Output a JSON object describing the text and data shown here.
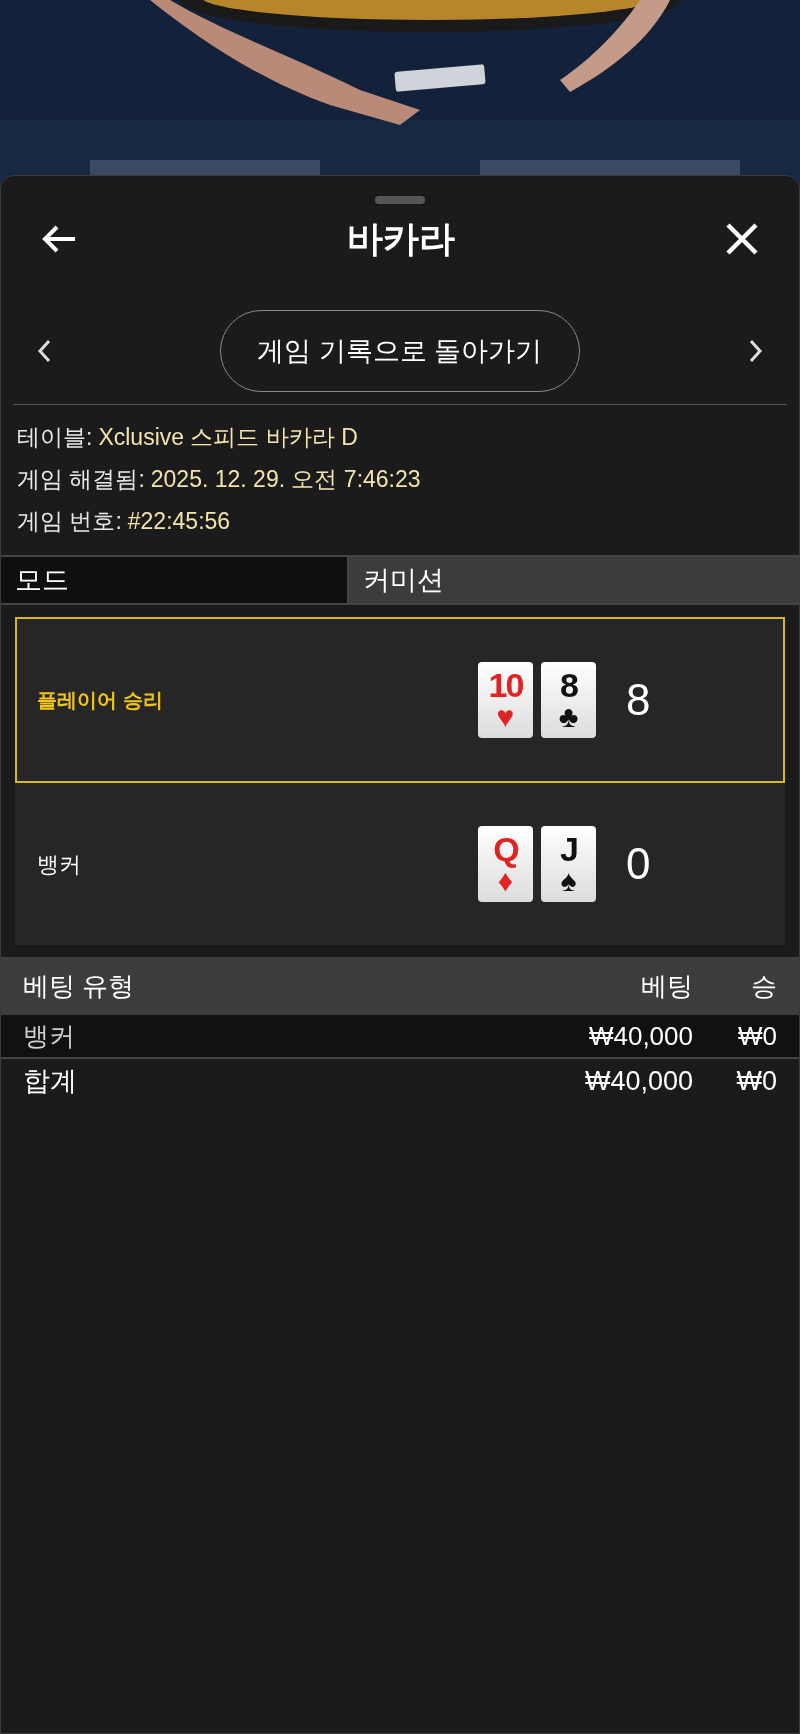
{
  "header": {
    "title": "바카라"
  },
  "nav": {
    "button": "게임 기록으로 돌아가기"
  },
  "info": [
    {
      "label": "테이블:",
      "value": "Xclusive 스피드 바카라 D"
    },
    {
      "label": "게임 해결됨:",
      "value": "2025. 12. 29. 오전 7:46:23"
    },
    {
      "label": "게임 번호:",
      "value": "#22:45:56"
    }
  ],
  "mode_row": {
    "label": "모드",
    "value": "커미션"
  },
  "hands": [
    {
      "label": "플레이어 승리",
      "won": true,
      "score": "8",
      "cards": [
        {
          "rank": "10",
          "suit": "♥",
          "color": "#e02424"
        },
        {
          "rank": "8",
          "suit": "♣",
          "color": "#111111"
        }
      ]
    },
    {
      "label": "뱅커",
      "won": false,
      "score": "0",
      "cards": [
        {
          "rank": "Q",
          "suit": "♦",
          "color": "#e02424"
        },
        {
          "rank": "J",
          "suit": "♠",
          "color": "#111111"
        }
      ]
    }
  ],
  "bets": {
    "columns": [
      "베팅 유형",
      "베팅",
      "승"
    ],
    "rows": [
      {
        "kind": "bet",
        "cells": [
          "뱅커",
          "₩40,000",
          "₩0"
        ]
      },
      {
        "kind": "total",
        "cells": [
          "합계",
          "₩40,000",
          "₩0"
        ]
      }
    ]
  }
}
